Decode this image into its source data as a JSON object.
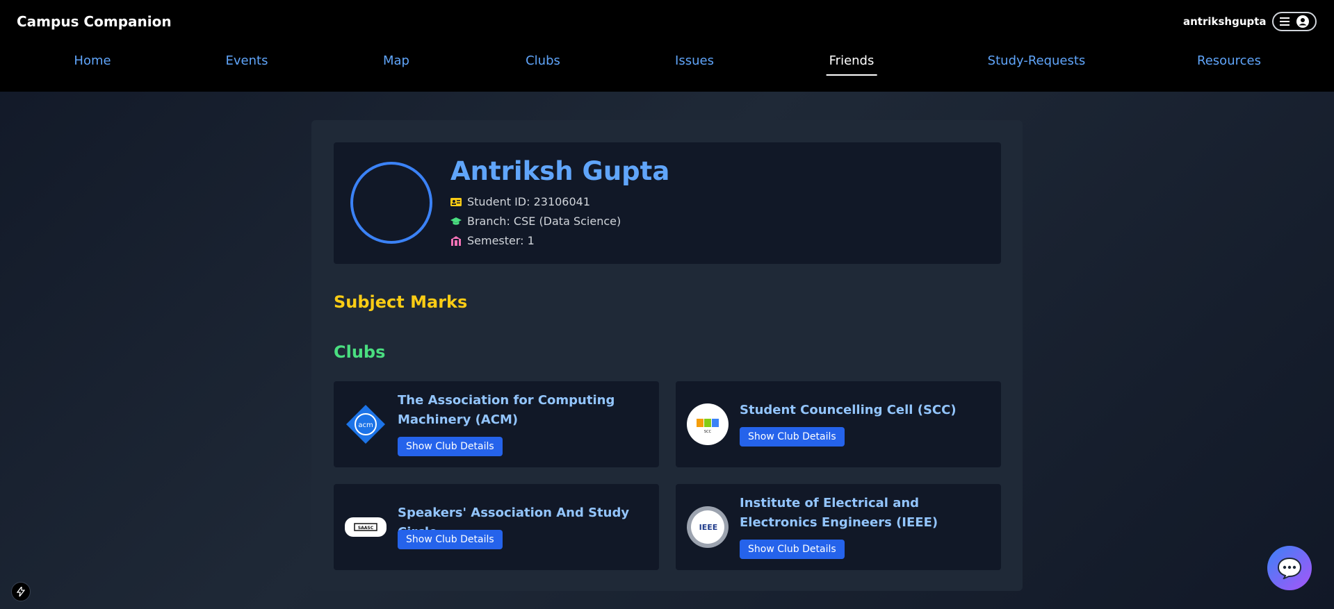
{
  "header": {
    "brand": "Campus Companion",
    "username": "antrikshgupta",
    "menu_icon": "hamburger-icon",
    "account_icon": "user-circle-icon"
  },
  "nav": {
    "items": [
      {
        "label": "Home",
        "active": false
      },
      {
        "label": "Events",
        "active": false
      },
      {
        "label": "Map",
        "active": false
      },
      {
        "label": "Clubs",
        "active": false
      },
      {
        "label": "Issues",
        "active": false
      },
      {
        "label": "Friends",
        "active": true
      },
      {
        "label": "Study-Requests",
        "active": false
      },
      {
        "label": "Resources",
        "active": false
      }
    ]
  },
  "profile": {
    "name": "Antriksh Gupta",
    "student_id": "Student ID: 23106041",
    "branch": "Branch: CSE (Data Science)",
    "semester": "Semester: 1"
  },
  "sections": {
    "marks_title": "Subject Marks",
    "clubs_title": "Clubs"
  },
  "clubs": [
    {
      "name": "The Association for Computing Machinery (ACM)",
      "button": "Show Club Details",
      "logo_text": "acm"
    },
    {
      "name": "Student Councelling Cell (SCC)",
      "button": "Show Club Details",
      "logo_text": "SCC"
    },
    {
      "name": "Speakers' Association And Study Circle",
      "button": "Show Club Details",
      "logo_text": "SAASC"
    },
    {
      "name": "Institute of Electrical and Electronics Engineers (IEEE)",
      "button": "Show Club Details",
      "logo_text": "IEEE"
    }
  ],
  "colors": {
    "accent_blue": "#60a5fa",
    "marks_yellow": "#facc15",
    "clubs_green": "#4ade80",
    "button_blue": "#2563eb"
  }
}
